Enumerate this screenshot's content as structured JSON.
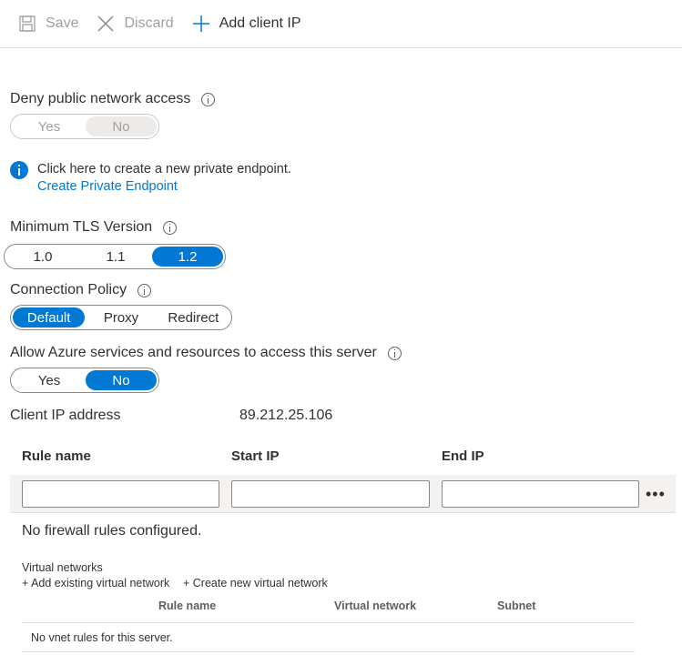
{
  "toolbar": {
    "save_label": "Save",
    "discard_label": "Discard",
    "add_client_ip_label": "Add client IP"
  },
  "deny_public": {
    "label": "Deny public network access",
    "options": [
      "Yes",
      "No"
    ],
    "selected": "No",
    "disabled": true
  },
  "private_endpoint": {
    "message": "Click here to create a new private endpoint.",
    "link": "Create Private Endpoint"
  },
  "tls": {
    "label": "Minimum TLS Version",
    "options": [
      "1.0",
      "1.1",
      "1.2"
    ],
    "selected": "1.2"
  },
  "connection_policy": {
    "label": "Connection Policy",
    "options": [
      "Default",
      "Proxy",
      "Redirect"
    ],
    "selected": "Default"
  },
  "azure_services": {
    "label": "Allow Azure services and resources to access this server",
    "options": [
      "Yes",
      "No"
    ],
    "selected": "No"
  },
  "client_ip": {
    "label": "Client IP address",
    "value": "89.212.25.106"
  },
  "firewall": {
    "columns": [
      "Rule name",
      "Start IP",
      "End IP"
    ],
    "rule_name_value": "",
    "start_ip_value": "",
    "end_ip_value": "",
    "row_actions_label": "•••",
    "empty_message": "No firewall rules configured."
  },
  "vnet": {
    "title": "Virtual networks",
    "add_existing_link": "+ Add existing virtual network",
    "create_new_link": "+ Create new virtual network",
    "columns": [
      "Rule name",
      "Virtual network",
      "Subnet"
    ],
    "empty_message": "No vnet rules for this server."
  },
  "colors": {
    "accent": "#0078d4",
    "text": "#323130",
    "disabled": "#a19f9d",
    "row_bg": "#f3f2f1"
  }
}
